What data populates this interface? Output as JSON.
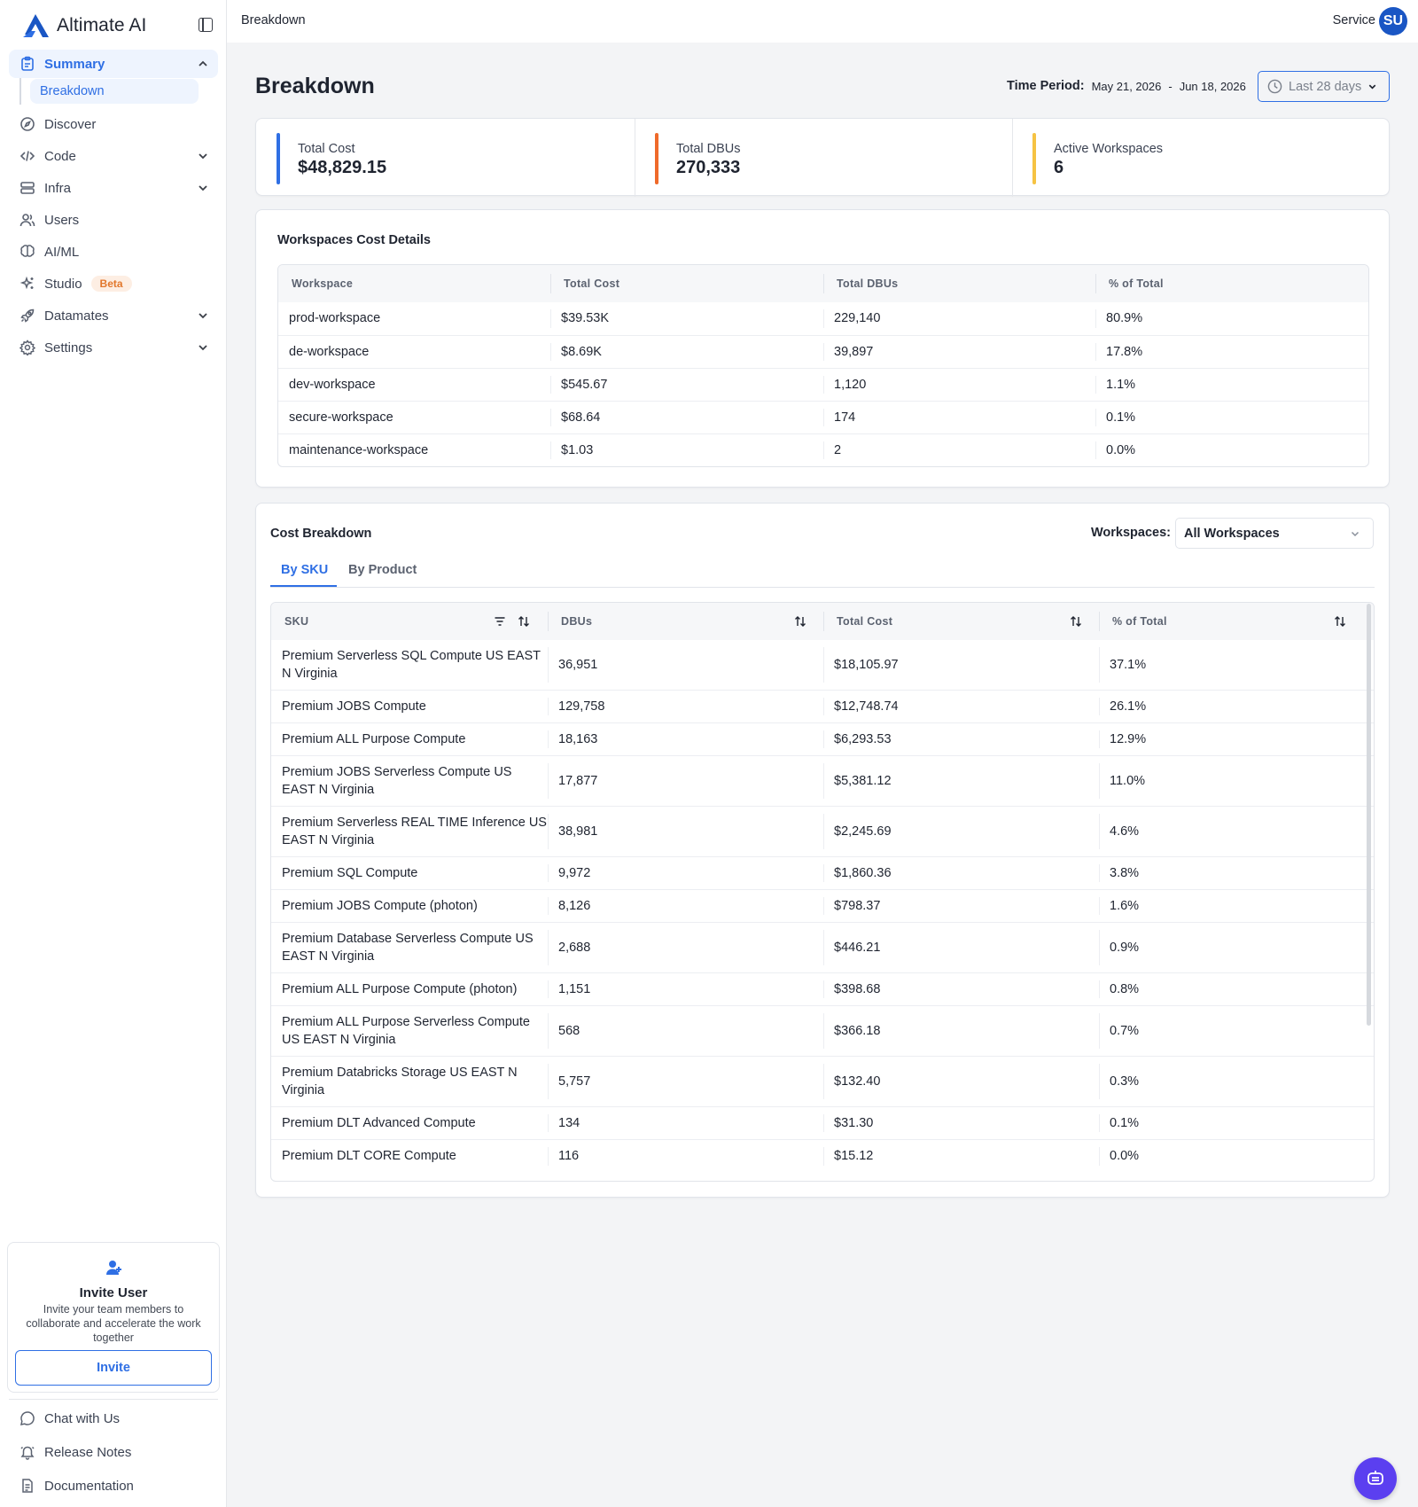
{
  "app": {
    "brand": "Altimate AI"
  },
  "sidebar": {
    "items": [
      {
        "label": "Summary",
        "icon": "clipboard-icon"
      },
      {
        "label": "Discover",
        "icon": "compass-icon"
      },
      {
        "label": "Code",
        "icon": "code-icon"
      },
      {
        "label": "Infra",
        "icon": "database-icon"
      },
      {
        "label": "Users",
        "icon": "users-icon"
      },
      {
        "label": "AI/ML",
        "icon": "brain-icon"
      },
      {
        "label": "Studio",
        "icon": "sparkles-icon",
        "badge": "Beta"
      },
      {
        "label": "Datamates",
        "icon": "rocket-icon"
      },
      {
        "label": "Settings",
        "icon": "gear-icon"
      }
    ],
    "sub_item": "Breakdown",
    "invite": {
      "title": "Invite User",
      "description": "Invite your team members to collaborate and accelerate the work together",
      "button": "Invite"
    },
    "footer": [
      {
        "label": "Chat with Us",
        "icon": "chat-icon"
      },
      {
        "label": "Release Notes",
        "icon": "bell-icon"
      },
      {
        "label": "Documentation",
        "icon": "document-icon"
      }
    ]
  },
  "topbar": {
    "breadcrumb": "Breakdown",
    "user_label": "Service",
    "avatar_initials": "SU"
  },
  "page": {
    "title": "Breakdown",
    "time_period_label": "Time Period:",
    "date_start": "May 21, 2026",
    "date_sep": "-",
    "date_end": "Jun 18, 2026",
    "range_button": "Last 28 days"
  },
  "kpis": [
    {
      "label": "Total Cost",
      "value": "$48,829.15",
      "color": "#2f6fe4"
    },
    {
      "label": "Total DBUs",
      "value": "270,333",
      "color": "#ef6a2a"
    },
    {
      "label": "Active Workspaces",
      "value": "6",
      "color": "#f6c343"
    }
  ],
  "workspaces_table": {
    "title": "Workspaces Cost Details",
    "headers": [
      "Workspace",
      "Total Cost",
      "Total DBUs",
      "% of Total"
    ],
    "rows": [
      [
        "prod-workspace",
        "$39.53K",
        "229,140",
        "80.9%"
      ],
      [
        "de-workspace",
        "$8.69K",
        "39,897",
        "17.8%"
      ],
      [
        "dev-workspace",
        "$545.67",
        "1,120",
        "1.1%"
      ],
      [
        "secure-workspace",
        "$68.64",
        "174",
        "0.1%"
      ],
      [
        "maintenance-workspace",
        "$1.03",
        "2",
        "0.0%"
      ]
    ]
  },
  "cost_breakdown": {
    "title": "Cost Breakdown",
    "workspace_filter_label": "Workspaces:",
    "workspace_filter_value": "All Workspaces",
    "tabs": [
      "By SKU",
      "By Product"
    ],
    "headers": [
      "SKU",
      "DBUs",
      "Total Cost",
      "% of Total"
    ],
    "rows": [
      [
        "Premium Serverless SQL Compute US EAST N Virginia",
        "36,951",
        "$18,105.97",
        "37.1%"
      ],
      [
        "Premium JOBS Compute",
        "129,758",
        "$12,748.74",
        "26.1%"
      ],
      [
        "Premium ALL Purpose Compute",
        "18,163",
        "$6,293.53",
        "12.9%"
      ],
      [
        "Premium JOBS Serverless Compute US EAST N Virginia",
        "17,877",
        "$5,381.12",
        "11.0%"
      ],
      [
        "Premium Serverless REAL TIME Inference US EAST N Virginia",
        "38,981",
        "$2,245.69",
        "4.6%"
      ],
      [
        "Premium SQL Compute",
        "9,972",
        "$1,860.36",
        "3.8%"
      ],
      [
        "Premium JOBS Compute (photon)",
        "8,126",
        "$798.37",
        "1.6%"
      ],
      [
        "Premium Database Serverless Compute US EAST N Virginia",
        "2,688",
        "$446.21",
        "0.9%"
      ],
      [
        "Premium ALL Purpose Compute (photon)",
        "1,151",
        "$398.68",
        "0.8%"
      ],
      [
        "Premium ALL Purpose Serverless Compute US EAST N Virginia",
        "568",
        "$366.18",
        "0.7%"
      ],
      [
        "Premium Databricks Storage US EAST N Virginia",
        "5,757",
        "$132.40",
        "0.3%"
      ],
      [
        "Premium DLT Advanced Compute",
        "134",
        "$31.30",
        "0.1%"
      ],
      [
        "Premium DLT CORE Compute",
        "116",
        "$15.12",
        "0.0%"
      ]
    ]
  },
  "colors": {
    "accent": "#2f6fe4",
    "fab": "#5b3ff0"
  }
}
